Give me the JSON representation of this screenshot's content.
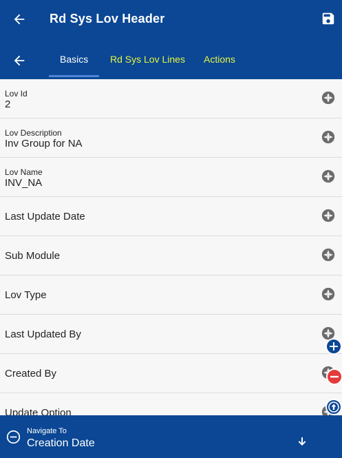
{
  "header": {
    "title": "Rd Sys Lov Header"
  },
  "tabs": [
    {
      "label": "Basics"
    },
    {
      "label": "Rd Sys Lov Lines"
    },
    {
      "label": "Actions"
    }
  ],
  "fields": [
    {
      "label": "Lov Id",
      "value": "2"
    },
    {
      "label": "Lov Description",
      "value": "Inv Group for NA"
    },
    {
      "label": "Lov Name",
      "value": "INV_NA"
    },
    {
      "label": "Last Update Date",
      "value": ""
    },
    {
      "label": "Sub Module",
      "value": ""
    },
    {
      "label": "Lov Type",
      "value": ""
    },
    {
      "label": "Last Updated By",
      "value": ""
    },
    {
      "label": "Created By",
      "value": ""
    },
    {
      "label": "Update Option",
      "value": ""
    }
  ],
  "footer": {
    "nav_label": "Navigate To",
    "nav_value": "Creation Date"
  },
  "colors": {
    "primary": "#0b4794",
    "tab_inactive": "#e5f542",
    "danger": "#e33b3b"
  },
  "icons": [
    "back-arrow-icon",
    "save-icon",
    "camera-aperture-icon",
    "plus-icon",
    "minus-icon",
    "arrow-up-icon",
    "minus-circle-icon",
    "arrow-down-icon"
  ]
}
